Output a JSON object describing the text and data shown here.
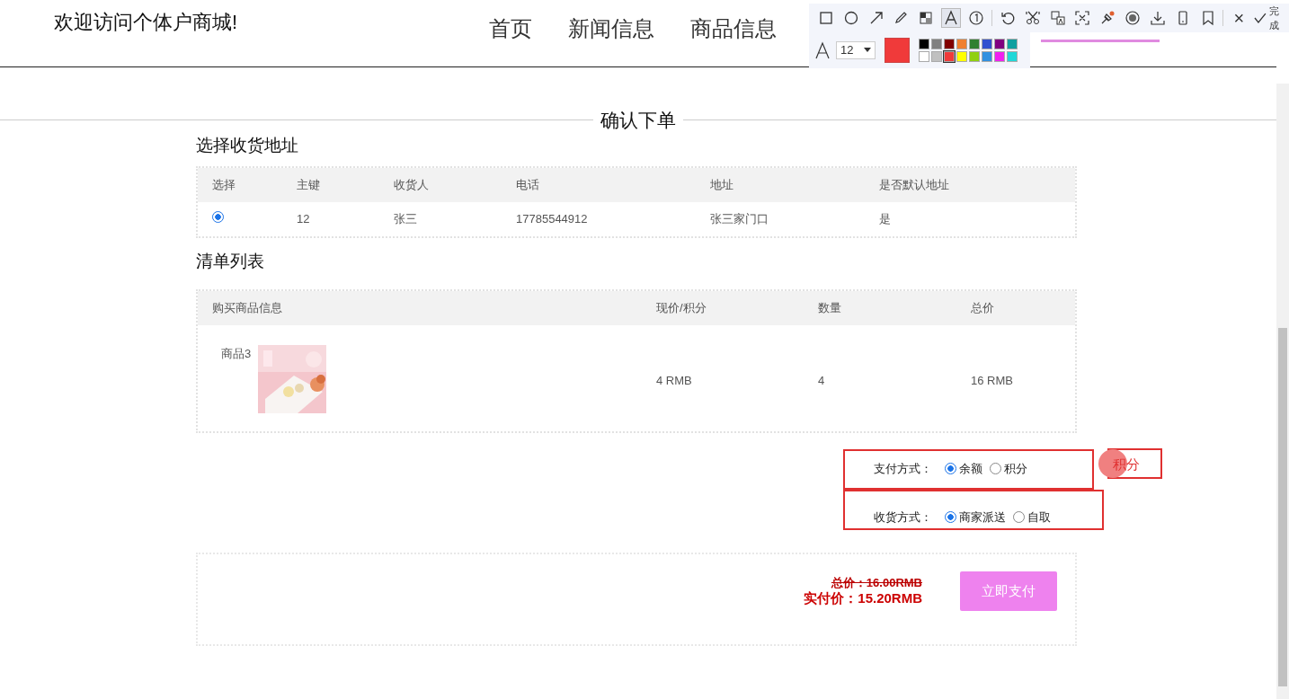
{
  "header": {
    "welcome": "欢迎访问个体户商城!",
    "nav": [
      {
        "label": "首页",
        "selected": false
      },
      {
        "label": "新闻信息",
        "selected": false
      },
      {
        "label": "商品信息",
        "selected": false
      }
    ]
  },
  "page_title": "确认下单",
  "address_section": {
    "title": "选择收货地址",
    "columns": [
      "选择",
      "主键",
      "收货人",
      "电话",
      "地址",
      "是否默认地址"
    ],
    "rows": [
      {
        "selected": true,
        "key": "12",
        "receiver": "张三",
        "phone": "17785544912",
        "address": "张三家门口",
        "is_default": "是"
      }
    ]
  },
  "list_section": {
    "title": "清单列表",
    "columns": [
      "购买商品信息",
      "现价/积分",
      "数量",
      "总价"
    ],
    "rows": [
      {
        "name": "商品3",
        "price": "4 RMB",
        "quantity": "4",
        "total": "16 RMB"
      }
    ]
  },
  "payment": {
    "label": "支付方式：",
    "options": [
      {
        "label": "余额",
        "selected": true
      },
      {
        "label": "积分",
        "selected": false
      }
    ]
  },
  "delivery": {
    "label": "收货方式：",
    "options": [
      {
        "label": "商家派送",
        "selected": true
      },
      {
        "label": "自取",
        "selected": false
      }
    ]
  },
  "summary": {
    "total": "总价：16.00RMB",
    "paid": "实付价：15.20RMB",
    "button": "立即支付"
  },
  "annotation_tool": {
    "tools": [
      {
        "kind": "rect",
        "selected": false
      },
      {
        "kind": "ellipse",
        "selected": false
      },
      {
        "kind": "arrow",
        "selected": false
      },
      {
        "kind": "pencil",
        "selected": false
      },
      {
        "kind": "mosaic",
        "selected": false
      },
      {
        "kind": "text",
        "selected": true
      },
      {
        "kind": "number",
        "selected": false
      },
      {
        "kind": "undo",
        "selected": false
      },
      {
        "kind": "scissors",
        "selected": false
      },
      {
        "kind": "translate",
        "selected": false
      },
      {
        "kind": "ocr",
        "selected": false
      },
      {
        "kind": "pin",
        "selected": false
      },
      {
        "kind": "record",
        "selected": false
      },
      {
        "kind": "download",
        "selected": false
      },
      {
        "kind": "phone",
        "selected": false
      },
      {
        "kind": "bookmark",
        "selected": false
      }
    ],
    "close": "×",
    "done_label": "完成",
    "font_size": "12",
    "palette": [
      {
        "color": "#000000",
        "selected": false
      },
      {
        "color": "#808080",
        "selected": false
      },
      {
        "color": "#800000",
        "selected": false
      },
      {
        "color": "#f08030",
        "selected": false
      },
      {
        "color": "#308030",
        "selected": false
      },
      {
        "color": "#3050d0",
        "selected": false
      },
      {
        "color": "#800080",
        "selected": false
      },
      {
        "color": "#10a0a0",
        "selected": false
      },
      {
        "color": "#ffffff",
        "selected": false
      },
      {
        "color": "#c0c0c0",
        "selected": false
      },
      {
        "color": "#f03a3a",
        "selected": true
      },
      {
        "color": "#ffff00",
        "selected": false
      },
      {
        "color": "#90d010",
        "selected": false
      },
      {
        "color": "#3090e0",
        "selected": false
      },
      {
        "color": "#f020f0",
        "selected": false
      },
      {
        "color": "#20d8d8",
        "selected": false
      }
    ]
  },
  "annotations": [
    {
      "kind": "rect"
    },
    {
      "kind": "rect"
    },
    {
      "kind": "rect"
    },
    {
      "kind": "marker"
    },
    {
      "kind": "text",
      "text": "积分"
    }
  ]
}
